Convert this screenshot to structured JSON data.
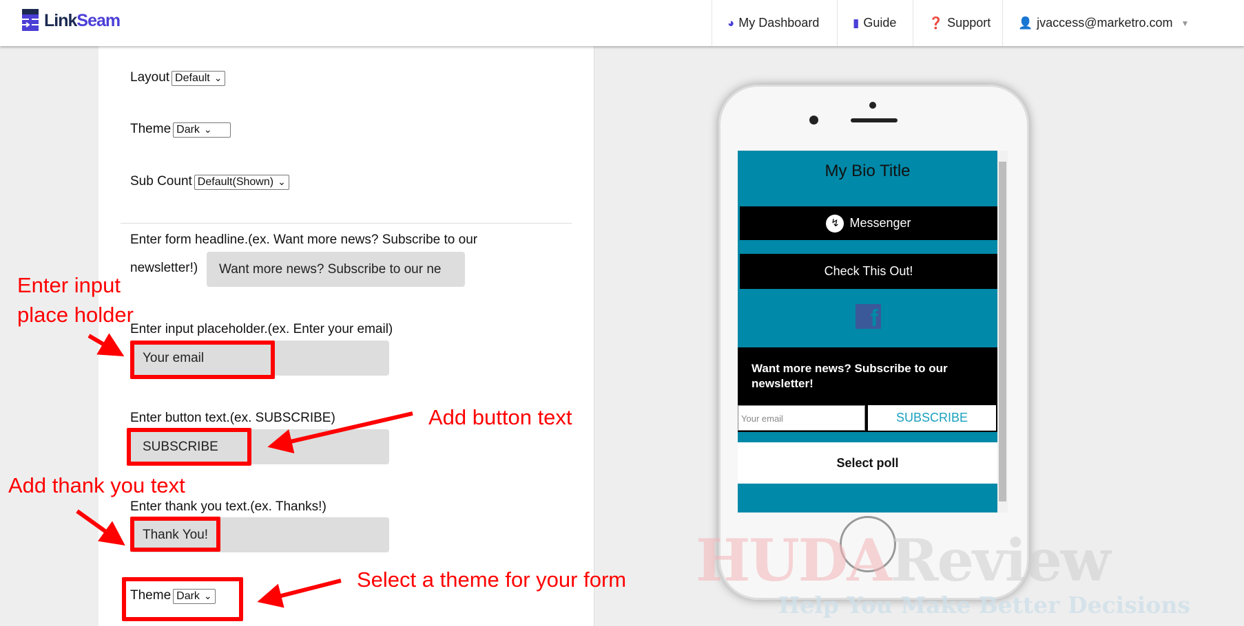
{
  "header": {
    "logo": "LinkSeam",
    "logo_parts": [
      "Link",
      "Seam"
    ],
    "nav": [
      {
        "icon": "dashboard-icon",
        "label": "My Dashboard"
      },
      {
        "icon": "book-icon",
        "label": "Guide"
      },
      {
        "icon": "question-circle-icon",
        "label": "Support"
      },
      {
        "icon": "user-icon",
        "label": "jvaccess@marketro.com"
      }
    ]
  },
  "form": {
    "layout": {
      "label": "Layout",
      "value": "Default"
    },
    "theme": {
      "label": "Theme",
      "value": "Dark"
    },
    "sub_count": {
      "label": "Sub Count",
      "value": "Default(Shown)"
    },
    "headline": {
      "label_1": "Enter form headline.(ex. Want more news? Subscribe to our",
      "label_2": "newsletter!)",
      "value": "Want more news? Subscribe to our ne"
    },
    "placeholder": {
      "label": "Enter input placeholder.(ex. Enter your email)",
      "value": "Your email"
    },
    "button_text": {
      "label": "Enter button text.(ex. SUBSCRIBE)",
      "value": "SUBSCRIBE"
    },
    "thank_you": {
      "label": "Enter thank you text.(ex. Thanks!)",
      "value": "Thank You!"
    },
    "form_theme": {
      "label": "Theme",
      "value": "Dark"
    }
  },
  "annotations": {
    "placeholder_1": "Enter input",
    "placeholder_2": "place holder",
    "button": "Add button text",
    "thank": "Add thank you text",
    "theme": "Select a theme for your form",
    "color": "#ff0000"
  },
  "preview": {
    "title": "My Bio Title",
    "buttons": [
      "Messenger",
      "Check This Out!"
    ],
    "form_headline": "Want more news? Subscribe to our newsletter!",
    "email_placeholder": "Your email",
    "subscribe": "SUBSCRIBE",
    "poll": "Select poll",
    "bg_color": "#0089a8"
  },
  "watermark": {
    "brand_1": "HUDA",
    "brand_2": "Review",
    "tagline": "Help You Make Better Decisions"
  }
}
